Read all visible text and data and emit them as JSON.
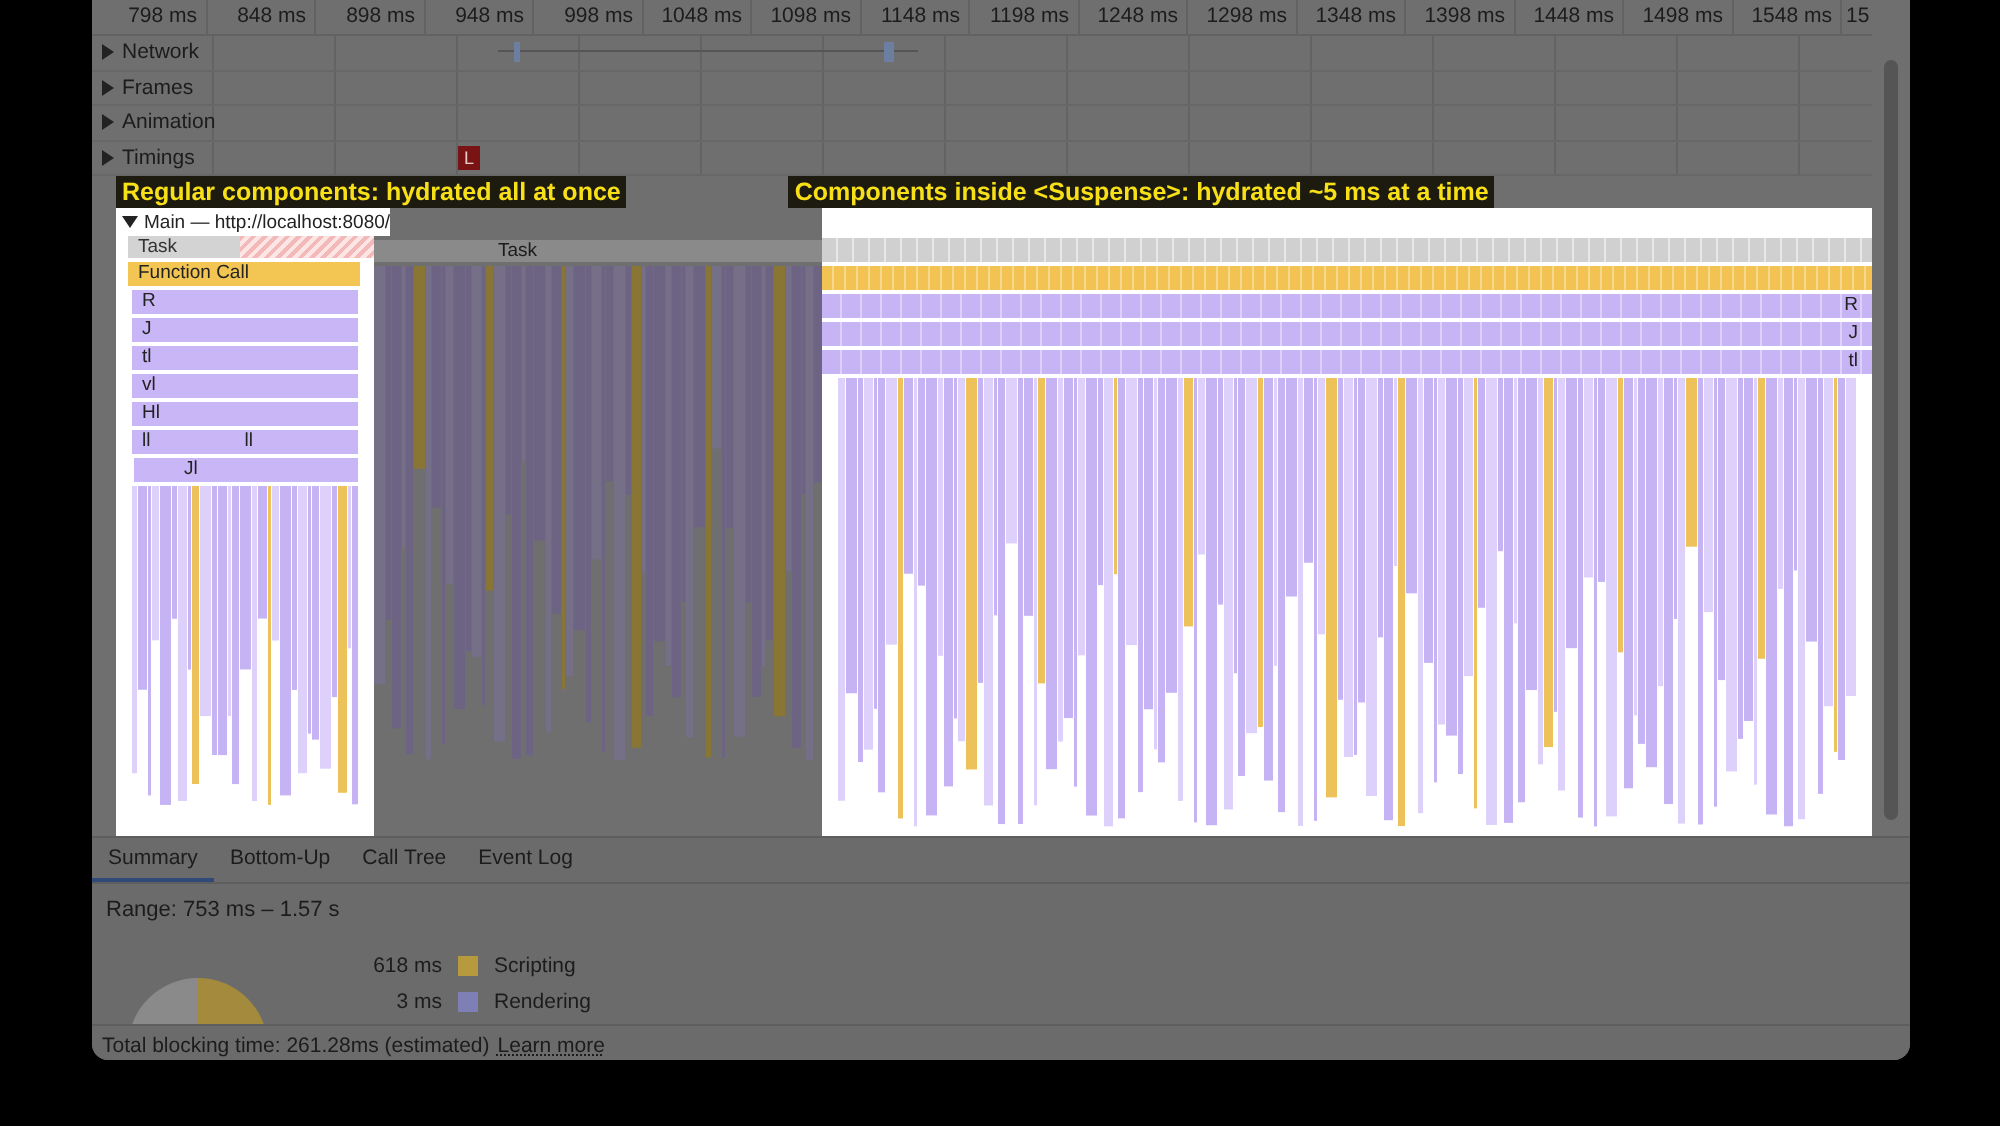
{
  "ruler": {
    "ticks": [
      "798 ms",
      "848 ms",
      "898 ms",
      "948 ms",
      "998 ms",
      "1048 ms",
      "1098 ms",
      "1148 ms",
      "1198 ms",
      "1248 ms",
      "1298 ms",
      "1348 ms",
      "1398 ms",
      "1448 ms",
      "1498 ms",
      "1548 ms",
      "15"
    ]
  },
  "tracks": [
    {
      "label": "Network",
      "expanded": false,
      "kind": "network"
    },
    {
      "label": "Frames",
      "expanded": false,
      "kind": "plain"
    },
    {
      "label": "Animation",
      "expanded": false,
      "kind": "plain"
    },
    {
      "label": "Timings",
      "expanded": false,
      "kind": "timings",
      "marker": "L"
    }
  ],
  "annotations": [
    "Regular components: hydrated all at once",
    "Components inside <Suspense>: hydrated ~5 ms at a time"
  ],
  "main_thread": {
    "title": "Main — http://localhost:8080/",
    "expanded": true,
    "tasks": [
      "Task",
      "Task"
    ],
    "left_rows": [
      {
        "labels": [
          "Function Call"
        ],
        "kind": "function"
      },
      {
        "labels": [
          "R"
        ],
        "kind": "call"
      },
      {
        "labels": [
          "J"
        ],
        "kind": "call"
      },
      {
        "labels": [
          "tl"
        ],
        "kind": "call"
      },
      {
        "labels": [
          "vl"
        ],
        "kind": "call"
      },
      {
        "labels": [
          "Hl"
        ],
        "kind": "call"
      },
      {
        "labels": [
          "ll",
          "ll"
        ],
        "kind": "call"
      },
      {
        "labels": [
          "Jl"
        ],
        "kind": "call"
      }
    ],
    "right_rows": [
      "R",
      "J",
      "tl"
    ]
  },
  "tabs": [
    {
      "label": "Summary",
      "selected": true
    },
    {
      "label": "Bottom-Up",
      "selected": false
    },
    {
      "label": "Call Tree",
      "selected": false
    },
    {
      "label": "Event Log",
      "selected": false
    }
  ],
  "summary": {
    "range": "Range: 753 ms – 1.57 s",
    "legend": [
      {
        "value": "618 ms",
        "label": "Scripting",
        "color": "#b89a3e"
      },
      {
        "value": "3 ms",
        "label": "Rendering",
        "color": "#7d7fb5"
      }
    ]
  },
  "footer": {
    "text": "Total blocking time: 261.28ms (estimated)",
    "link": "Learn more"
  }
}
